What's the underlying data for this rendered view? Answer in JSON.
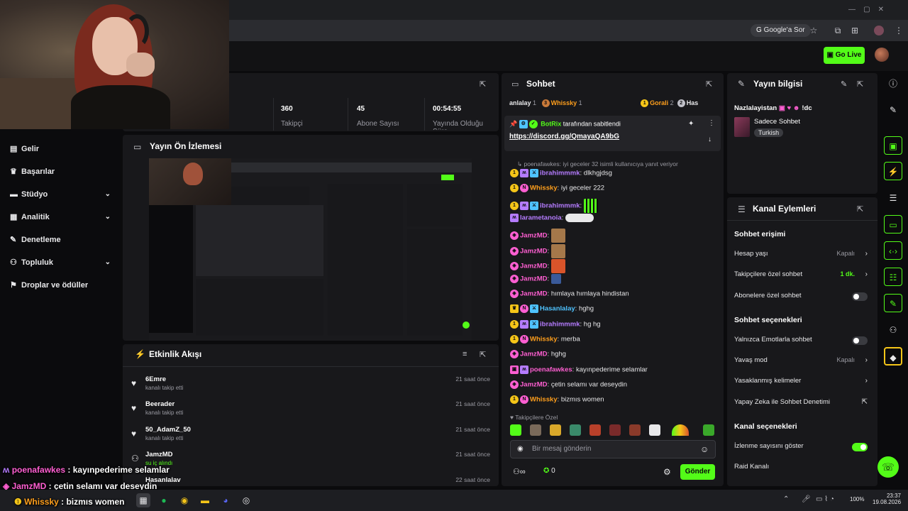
{
  "browser": {
    "google_btn": "Google'a Sor"
  },
  "header": {
    "go_live": "Go Live"
  },
  "sidebar": {
    "items": [
      {
        "label": "Gelir",
        "icon": "wallet-icon",
        "chevron": false
      },
      {
        "label": "Başarılar",
        "icon": "trophy-icon",
        "chevron": false
      },
      {
        "label": "Stüdyo",
        "icon": "studio-icon",
        "chevron": true
      },
      {
        "label": "Analitik",
        "icon": "analytics-icon",
        "chevron": true
      },
      {
        "label": "Denetleme",
        "icon": "wrench-icon",
        "chevron": false
      },
      {
        "label": "Topluluk",
        "icon": "community-icon",
        "chevron": true
      },
      {
        "label": "Droplar ve ödüller",
        "icon": "gift-icon",
        "chevron": false
      }
    ]
  },
  "stats": [
    {
      "value": "360",
      "label": "Takipçi"
    },
    {
      "value": "45",
      "label": "Abone Sayısı"
    },
    {
      "value": "00:54:55",
      "label": "Yayında Olduğu Süre"
    }
  ],
  "preview": {
    "title": "Yayın Ön İzlemesi"
  },
  "activity": {
    "title": "Etkinlik Akışı",
    "items": [
      {
        "name": "6Emre",
        "action": "kanalı takip etti",
        "time": "21 saat önce",
        "icon": "heart-icon"
      },
      {
        "name": "Beerader",
        "action": "kanalı takip etti",
        "time": "21 saat önce",
        "icon": "heart-icon"
      },
      {
        "name": "50_AdamZ_50",
        "action": "kanalı takip etti",
        "time": "21 saat önce",
        "icon": "heart-icon"
      },
      {
        "name": "JamzMD",
        "action": "su iç alındı",
        "time": "21 saat önce",
        "icon": "redeem-icon"
      },
      {
        "name": "Hasanlalav",
        "action": "",
        "time": "22 saat önce",
        "icon": "heart-icon"
      }
    ]
  },
  "chat": {
    "title": "Sohbet",
    "top_users": [
      {
        "name": "anlalay",
        "count": "1"
      },
      {
        "rank": "3",
        "name": "Whissky",
        "count": "1"
      },
      {
        "rank": "1",
        "name": "Gorali",
        "count": "2"
      },
      {
        "rank": "2",
        "name": "Has",
        "count": ""
      }
    ],
    "pinned": {
      "by": "BotRix",
      "suffix": "tarafından sabitlendi",
      "link": "https://discord.gg/QmayaQA9bG"
    },
    "reply_context": "poenafawkes: iyi geceler 32 isimli kullanıcıya yanıt veriyor",
    "messages": [
      {
        "user": "ibrahimmmk",
        "color": "#b57cff",
        "text": "dlkhgjdsg"
      },
      {
        "user": "Whissky",
        "color": "#ff9f1c",
        "text": "iyi geceler 222"
      },
      {
        "user": "ibrahimmmk",
        "color": "#b57cff",
        "text": ""
      },
      {
        "user": "larametanoia",
        "color": "#b57cff",
        "text": ""
      },
      {
        "user": "JamzMD",
        "color": "#ff5fd2",
        "text": ""
      },
      {
        "user": "JamzMD",
        "color": "#ff5fd2",
        "text": ""
      },
      {
        "user": "JamzMD",
        "color": "#ff5fd2",
        "text": ""
      },
      {
        "user": "JamzMD",
        "color": "#ff5fd2",
        "text": ""
      },
      {
        "user": "JamzMD",
        "color": "#ff5fd2",
        "text": "hımlaya hımlaya hindistan"
      },
      {
        "user": "Hasanlalay",
        "color": "#4fc3ff",
        "text": "hghg"
      },
      {
        "user": "ibrahimmmk",
        "color": "#b57cff",
        "text": "hg hg"
      },
      {
        "user": "Whissky",
        "color": "#ff9f1c",
        "text": "merba"
      },
      {
        "user": "JamzMD",
        "color": "#ff5fd2",
        "text": "hghg"
      },
      {
        "user": "poenafawkes",
        "color": "#ff5fd2",
        "text": "kayınpederime selamlar"
      },
      {
        "user": "JamzMD",
        "color": "#ff5fd2",
        "text": "çetin selamı var deseydin"
      },
      {
        "user": "Whissky",
        "color": "#ff9f1c",
        "text": "bizmıs women"
      }
    ],
    "followers_only": "Takipçilere Özel",
    "input_placeholder": "Bir mesaj gönderin",
    "points": "0",
    "send": "Gönder"
  },
  "stream_info": {
    "title": "Yayın bilgisi",
    "stream_title": "Nazlalayistan",
    "stream_title_suffix": "!dc",
    "category": "Sadece Sohbet",
    "tag": "Turkish"
  },
  "channel_actions": {
    "title": "Kanal Eylemleri",
    "chat_access": "Sohbet erişimi",
    "account_age": "Hesap yaşı",
    "account_age_val": "Kapalı",
    "followers_only": "Takipçilere özel sohbet",
    "followers_only_val": "1 dk.",
    "subs_only": "Abonelere özel sohbet",
    "chat_options": "Sohbet seçenekleri",
    "emote_only": "Yalnızca Emotlarla sohbet",
    "slow_mode": "Yavaş mod",
    "slow_mode_val": "Kapalı",
    "banned_words": "Yasaklanmış kelimeler",
    "ai_moderation": "Yapay Zeka ile Sohbet Denetimi",
    "channel_options": "Kanal seçenekleri",
    "show_viewers": "İzlenme sayısını göster",
    "raid": "Raid Kanalı"
  },
  "overlay": {
    "lines": [
      {
        "user": "poenafawkes",
        "color": "#ff5fd2",
        "text": "kayınpederime selamlar"
      },
      {
        "user": "JamzMD",
        "color": "#ff5fd2",
        "text": "çetin selamı var deseydin"
      },
      {
        "user": "Whissky",
        "color": "#ff9f1c",
        "text": "bizmıs women"
      }
    ]
  },
  "taskbar": {
    "battery": "100%",
    "time": "23:37",
    "date": "19.08.2026"
  }
}
